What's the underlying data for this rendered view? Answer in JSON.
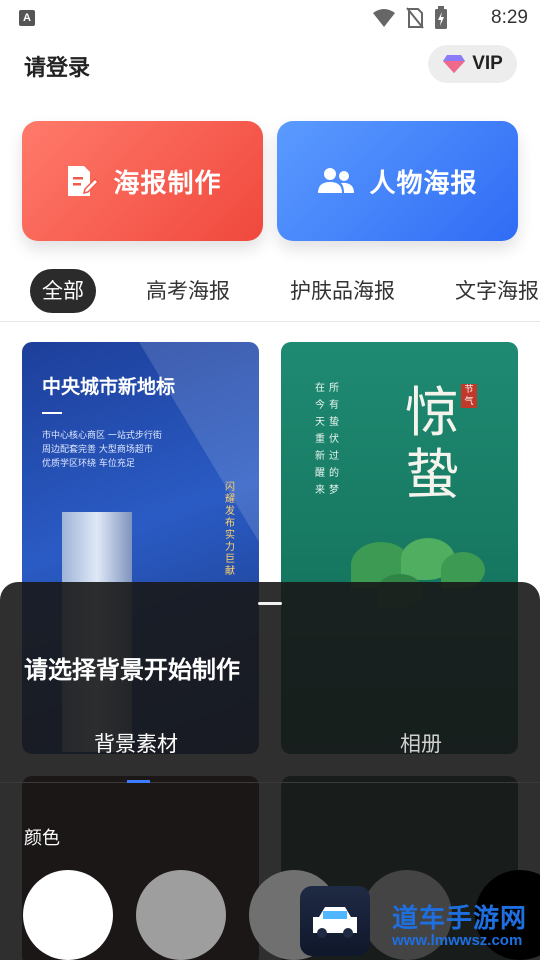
{
  "status_bar": {
    "time": "8:29",
    "notification_icon": "A"
  },
  "header": {
    "login_text": "请登录",
    "vip_label": "VIP"
  },
  "actions": {
    "poster_label": "海报制作",
    "person_label": "人物海报"
  },
  "categories": [
    "全部",
    "高考海报",
    "护肤品海报",
    "文字海报"
  ],
  "active_category": "全部",
  "cards": [
    {
      "title": "中央城市新地标",
      "lines": [
        "市中心核心商区  一站式步行街",
        "周边配套完善  大型商场超市",
        "优质学区环绕  车位充足"
      ],
      "vertical": "闪耀发布 实力巨献"
    },
    {
      "big_text": "惊蛰",
      "stamp": "节气",
      "poem": [
        "在今天重新醒来",
        "所有蛰伏过的梦"
      ]
    }
  ],
  "sheet": {
    "title": "请选择背景开始制作",
    "tabs": [
      "背景素材",
      "相册"
    ],
    "active_tab": "背景素材",
    "color_label": "颜色",
    "swatches": [
      "#ffffff",
      "#9e9e9e",
      "#707070",
      "#444444",
      "#000000"
    ],
    "accent": "#3d7bff"
  },
  "watermark": {
    "name": "道车手游网",
    "url": "www.lmwwsz.com"
  }
}
